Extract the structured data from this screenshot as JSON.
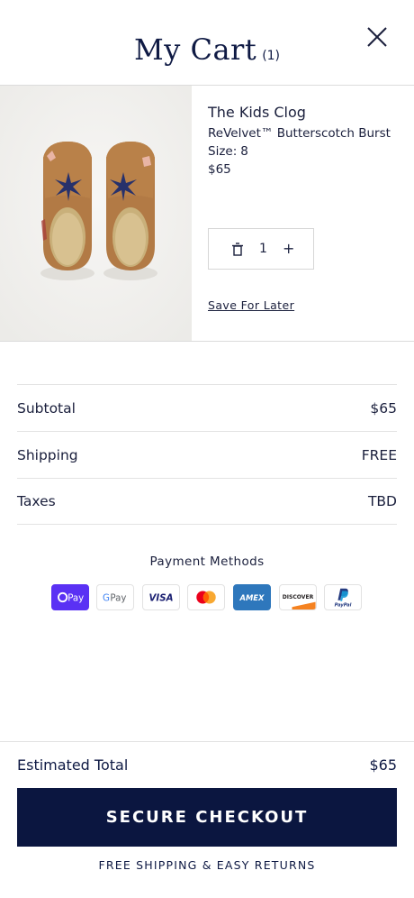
{
  "header": {
    "title": "My Cart",
    "count": "(1)",
    "close_icon": "close-icon"
  },
  "item": {
    "image_alt": "Pair of tan suede kids clogs with navy star embroidery",
    "name": "The Kids Clog",
    "variant": "ReVelvet™ Butterscotch Burst",
    "size_label": "Size:",
    "size_value": "8",
    "price": "$65",
    "quantity": "1",
    "trash_icon": "trash-icon",
    "plus_label": "+",
    "save_for_later": "Save For Later"
  },
  "summary": {
    "subtotal_label": "Subtotal",
    "subtotal_value": "$65",
    "shipping_label": "Shipping",
    "shipping_value": "FREE",
    "taxes_label": "Taxes",
    "taxes_value": "TBD"
  },
  "payment": {
    "title": "Payment Methods",
    "methods": [
      "OPay",
      "G Pay",
      "VISA",
      "Mastercard",
      "AMEX",
      "DISCOVER",
      "PayPal"
    ],
    "labels": {
      "opay": "Pay",
      "gpay_g": "G",
      "gpay_pay": "Pay",
      "visa": "VISA",
      "amex": "AMEX",
      "discover": "DISCOVER",
      "paypal": "PayPal"
    }
  },
  "footer": {
    "estimated_total_label": "Estimated Total",
    "estimated_total_value": "$65",
    "checkout_label": "SECURE CHECKOUT",
    "shipping_note": "FREE SHIPPING & EASY RETURNS"
  },
  "colors": {
    "navy": "#0b1640",
    "divider": "#e3e3e3",
    "opay_purple": "#5a31f4",
    "amex_blue": "#2e77bc",
    "discover_orange": "#f58220",
    "mastercard_red": "#eb001b",
    "mastercard_yellow": "#f79e1b"
  }
}
